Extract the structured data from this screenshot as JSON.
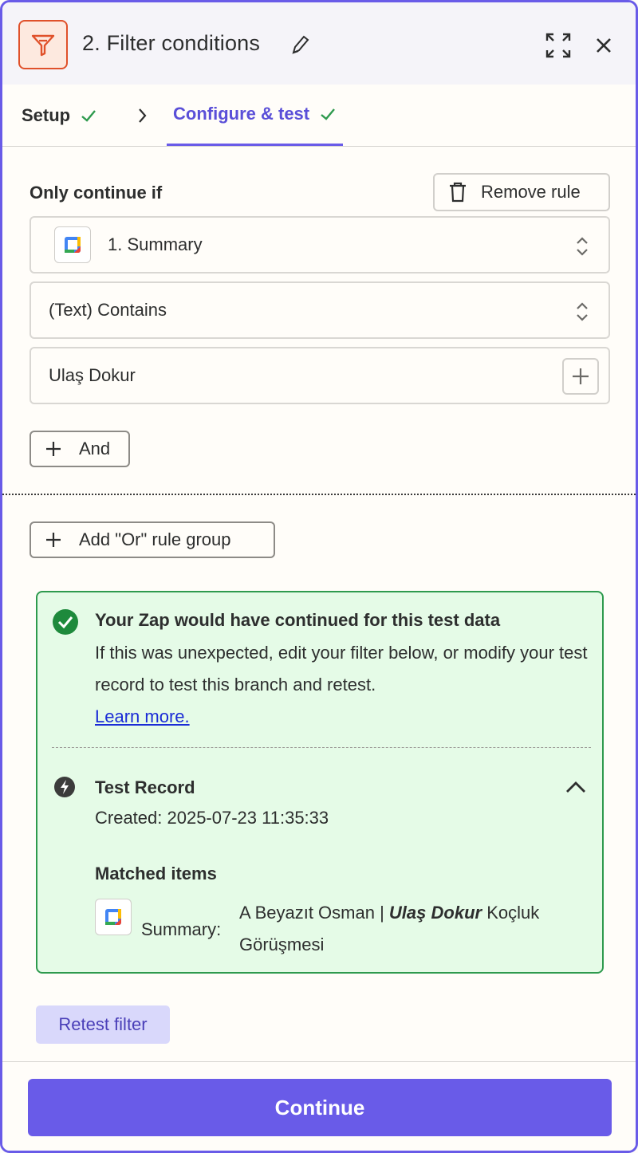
{
  "header": {
    "title": "2. Filter conditions",
    "app_icon": "filter-icon",
    "accent_color": "#e0512a"
  },
  "tabs": [
    {
      "label": "Setup",
      "status": "complete"
    },
    {
      "label": "Configure & test",
      "status": "complete",
      "active": true
    }
  ],
  "rule": {
    "label": "Only continue if",
    "remove_label": "Remove rule",
    "field": "1. Summary",
    "field_app_icon": "google-calendar-icon",
    "condition": "(Text) Contains",
    "value": "Ulaş Dokur"
  },
  "buttons": {
    "and_label": "And",
    "or_label": "Add \"Or\" rule group",
    "retest_label": "Retest filter",
    "continue_label": "Continue"
  },
  "result": {
    "title": "Your Zap would have continued for this test data",
    "body": "If this was unexpected, edit your filter below, or modify your test record to test this branch and retest.",
    "link": "Learn more.",
    "record_title": "Test Record",
    "created": "Created: 2025-07-23 11:35:33",
    "matched_title": "Matched items",
    "match_key": "Summary:",
    "match_prefix": "A Beyazıt Osman |",
    "match_highlight": "Ulaş Dokur",
    "match_suffix": "Koçluk Görüşmesi",
    "success_color": "#2e9a4e"
  },
  "colors": {
    "primary": "#695be8",
    "success_bg": "#e5fbe7"
  }
}
